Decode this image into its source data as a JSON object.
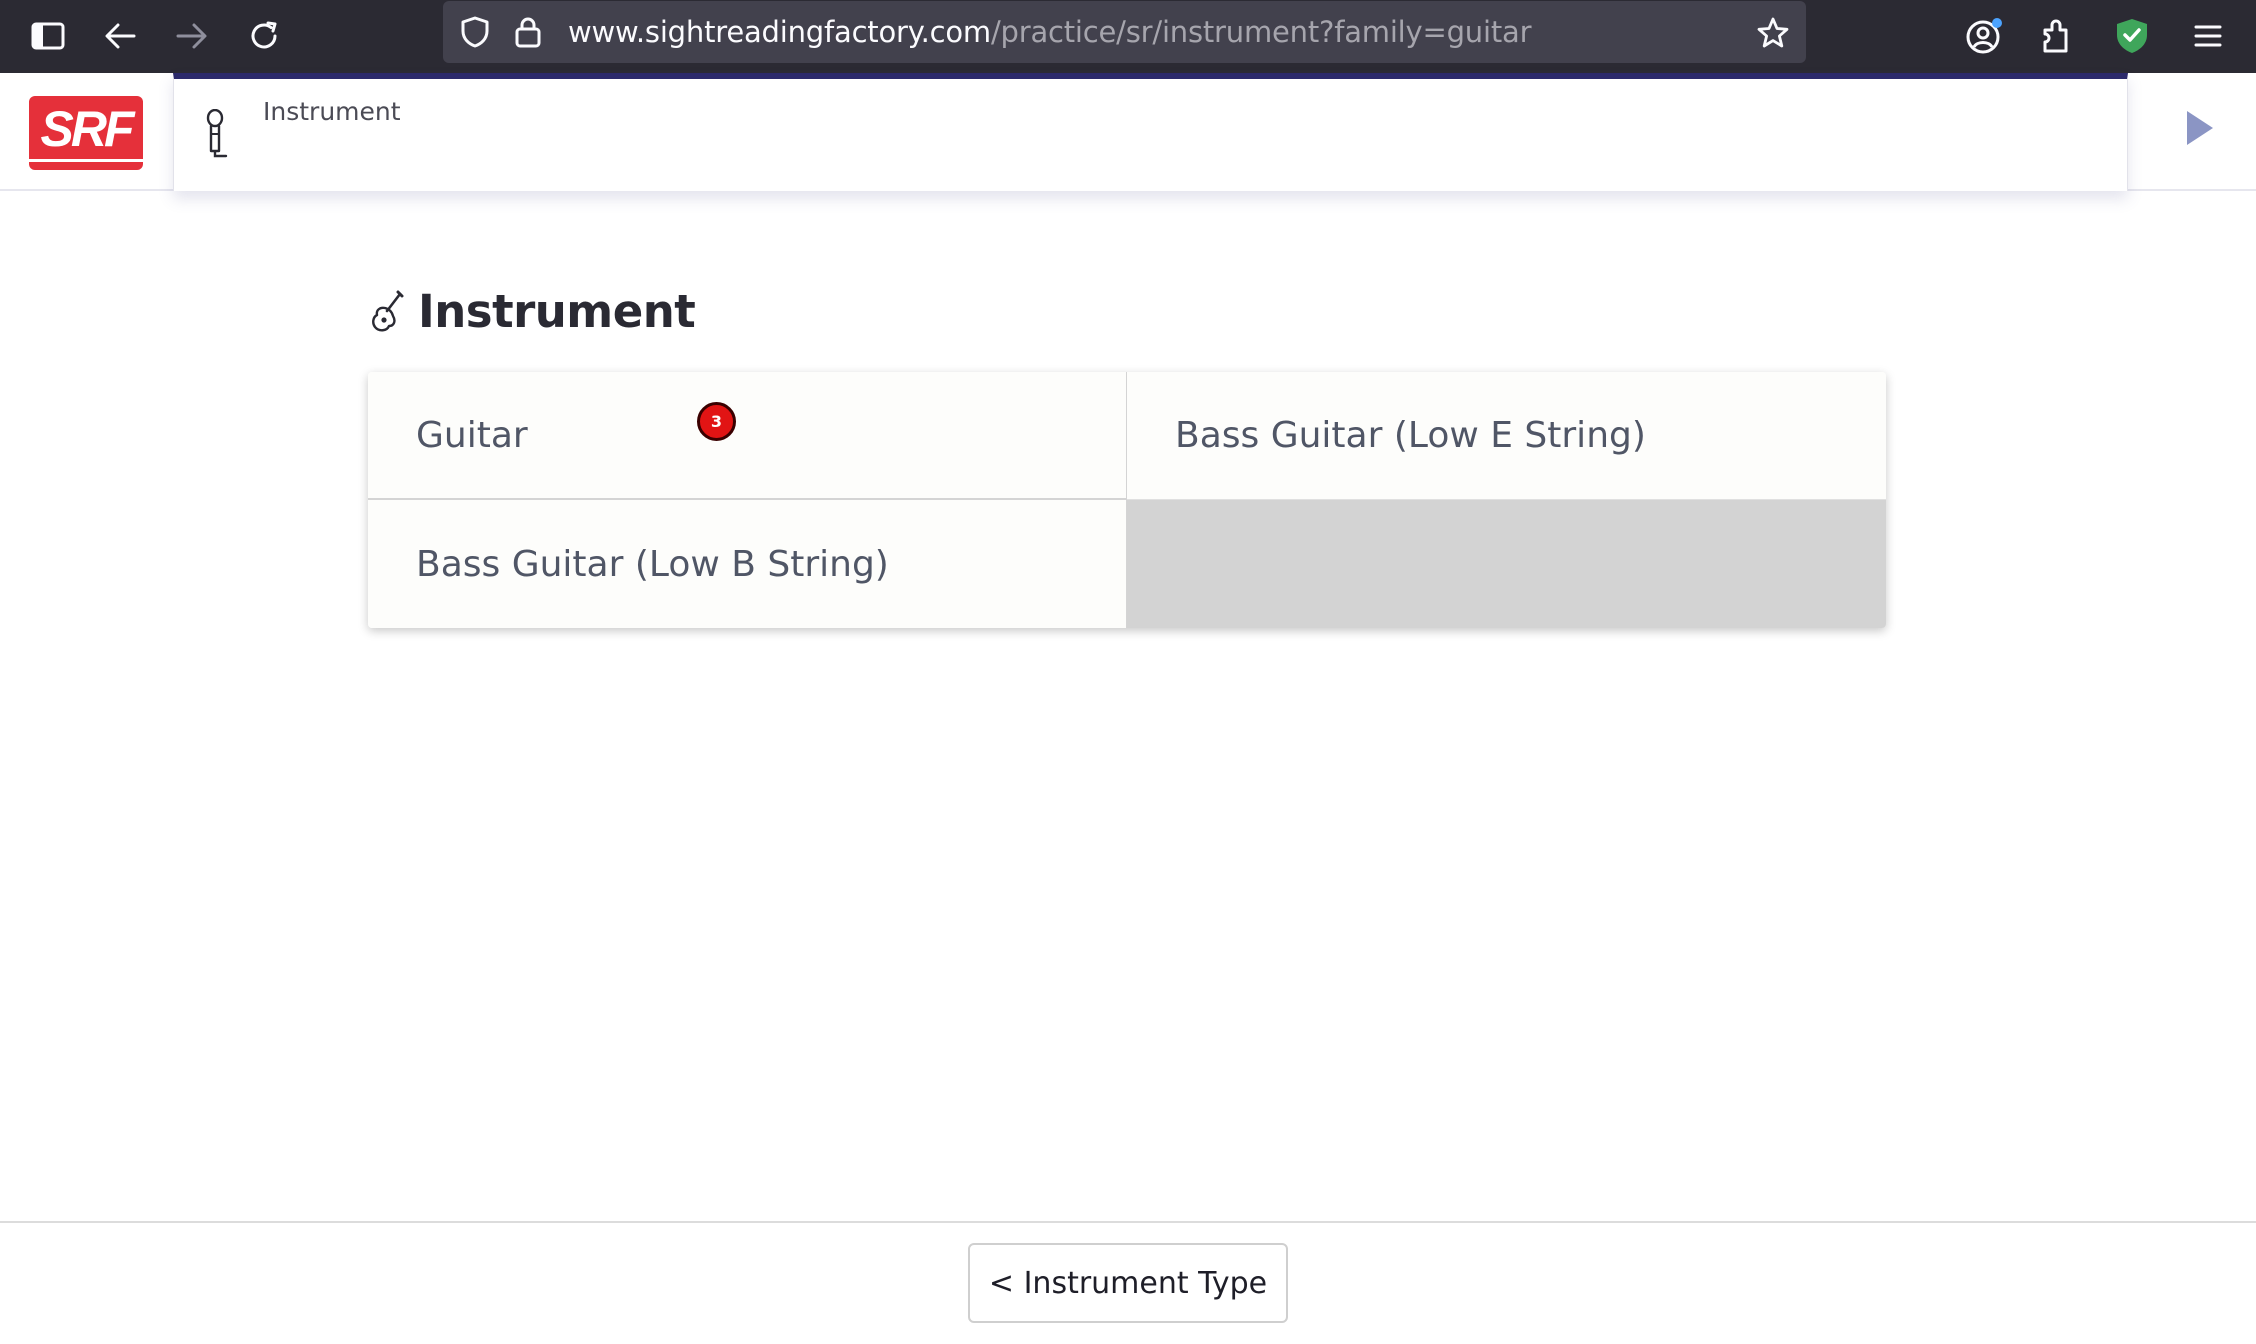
{
  "browser": {
    "url_host": "www.sightreadingfactory.com",
    "url_path": "/practice/sr/instrument?family=guitar",
    "icons": [
      "sidebar-icon",
      "back-arrow-icon",
      "forward-arrow-icon",
      "reload-icon",
      "shield-icon",
      "lock-icon",
      "star-icon",
      "account-icon",
      "extensions-icon",
      "privacy-badger-icon",
      "menu-icon"
    ]
  },
  "header": {
    "logo_text": "SRF",
    "breadcrumb_label": "Instrument",
    "breadcrumb_icon": "microphone-icon",
    "next_icon": "play-arrow-icon",
    "accent_color": "#2c2a6b",
    "logo_color": "#e5303a"
  },
  "main": {
    "title": "Instrument",
    "title_icon": "guitar-icon",
    "options": [
      {
        "label": "Guitar"
      },
      {
        "label": "Bass Guitar (Low E String)"
      },
      {
        "label": "Bass Guitar (Low B String)"
      }
    ],
    "badge_count": "3"
  },
  "footer": {
    "back_button_label": "< Instrument Type"
  }
}
